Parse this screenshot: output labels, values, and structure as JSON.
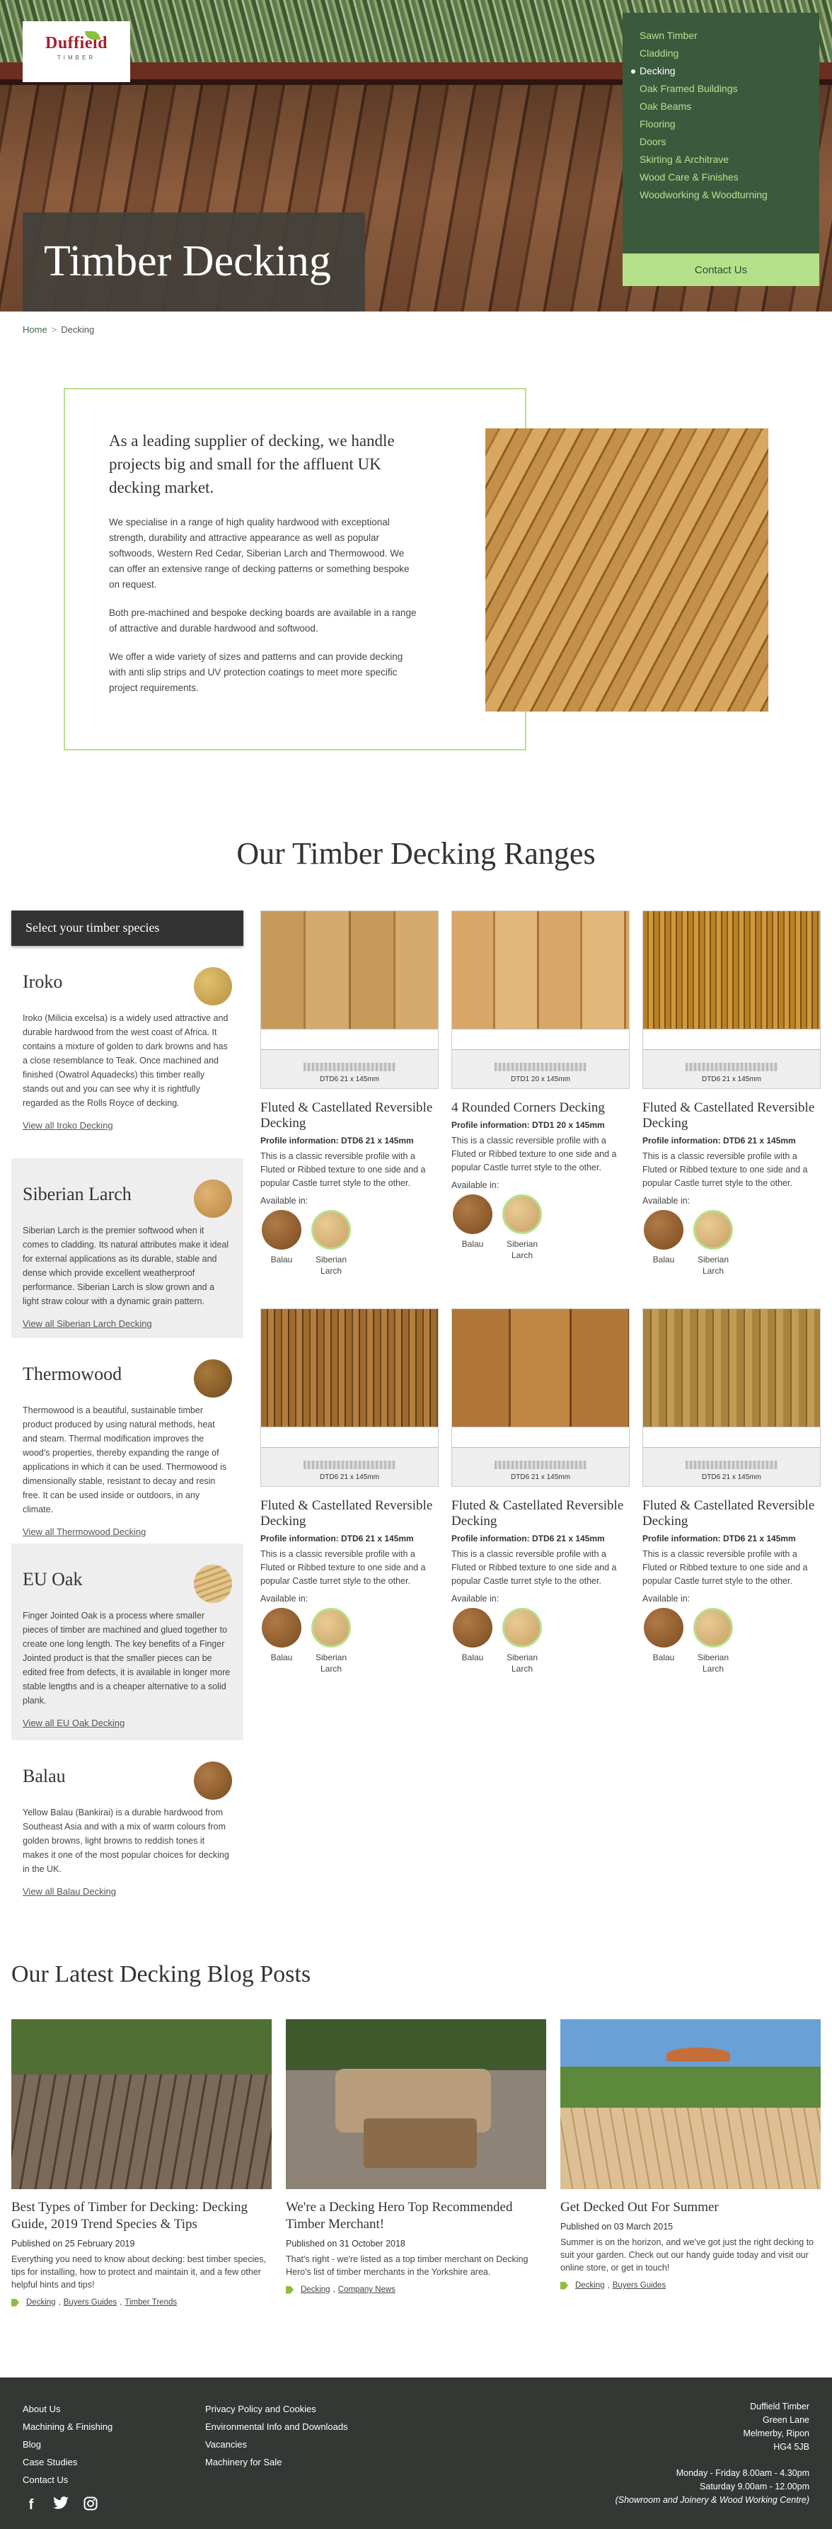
{
  "logo": {
    "name": "Duffield",
    "sub": "TIMBER"
  },
  "nav": {
    "items": [
      "Sawn Timber",
      "Cladding",
      "Decking",
      "Oak Framed Buildings",
      "Oak Beams",
      "Flooring",
      "Doors",
      "Skirting & Architrave",
      "Wood Care & Finishes",
      "Woodworking & Woodturning"
    ],
    "active": "Decking",
    "contact_label": "Contact Us"
  },
  "hero": {
    "title": "Timber Decking"
  },
  "breadcrumb": {
    "home": "Home",
    "current": "Decking"
  },
  "intro": {
    "heading": "As a leading supplier of decking, we handle projects big and small for the affluent UK decking market.",
    "p1": "We specialise in a range of high quality hardwood with exceptional strength, durability and attractive appearance as well as popular softwoods, Western Red Cedar, Siberian Larch and Thermowood. We can offer an extensive range of decking patterns or something bespoke on request.",
    "p2": "Both pre-machined and bespoke decking boards are available in a range of attractive and durable hardwood and softwood.",
    "p3": "We offer a wide variety of sizes and patterns and can provide decking with anti slip strips and UV protection coatings to meet more specific project requirements."
  },
  "ranges": {
    "title": "Our Timber Decking Ranges",
    "sidebar_title": "Select your timber species",
    "species": [
      {
        "name": "Iroko",
        "text": "Iroko (Milicia excelsa) is a widely used attractive and durable hardwood from the west coast of Africa. It contains a mixture of golden to dark browns and has a close resemblance to Teak. Once machined and finished (Owatrol Aquadecks) this timber really stands out and you can see why it is rightfully regarded as the Rolls Royce of decking.",
        "link": "View all Iroko Decking"
      },
      {
        "name": "Siberian Larch",
        "text": "Siberian Larch is the premier softwood when it comes to cladding. Its natural attributes make it ideal for external applications as its durable, stable and dense which provide excellent weatherproof performance. Siberian Larch is slow grown and a light straw colour with a dynamic grain pattern.",
        "link": "View all Siberian Larch Decking"
      },
      {
        "name": "Thermowood",
        "text": "Thermowood is a beautiful, sustainable timber product produced by using natural methods, heat and steam. Thermal modification improves the wood's properties, thereby expanding the range of applications in which it can be used. Thermowood is dimensionally stable, resistant to decay and resin free. It can be used inside or outdoors, in any climate.",
        "link": "View all Thermowood Decking"
      },
      {
        "name": "EU Oak",
        "text": "Finger Jointed Oak is a process where smaller pieces of timber are machined and glued together to create one long length. The key benefits of a Finger Jointed product is that the smaller pieces can be edited free from defects, it is available in longer more stable lengths and is a cheaper alternative to a solid plank.",
        "link": "View all EU Oak Decking"
      },
      {
        "name": "Balau",
        "text": "Yellow Balau (Bankirai) is a durable hardwood from Southeast Asia and with a mix of warm colours from golden browns, light browns to reddish tones it makes it one of the most popular choices for decking in the UK.",
        "link": "View all Balau Decking"
      }
    ],
    "products": [
      {
        "dim": "DTD6 21 x 145mm",
        "title": "Fluted & Castellated Reversible Decking",
        "info": "Profile information: DTD6 21 x 145mm",
        "desc": "This is a classic reversible profile with a Fluted or Ribbed texture to one side and a popular Castle turret style to the other.",
        "avail": "Available in:",
        "sw1": "Balau",
        "sw2": "Siberian Larch"
      },
      {
        "dim": "DTD1 20 x 145mm",
        "title": "4 Rounded Corners Decking",
        "info": "Profile information: DTD1 20 x 145mm",
        "desc": "This is a classic reversible profile with a Fluted or Ribbed texture to one side and a popular Castle turret style to the other.",
        "avail": "Available in:",
        "sw1": "Balau",
        "sw2": "Siberian Larch"
      },
      {
        "dim": "DTD6 21 x 145mm",
        "title": "Fluted & Castellated Reversible Decking",
        "info": "Profile information: DTD6 21 x 145mm",
        "desc": "This is a classic reversible profile with a Fluted or Ribbed texture to one side and a popular Castle turret style to the other.",
        "avail": "Available in:",
        "sw1": "Balau",
        "sw2": "Siberian Larch"
      },
      {
        "dim": "DTD6 21 x 145mm",
        "title": "Fluted & Castellated Reversible Decking",
        "info": "Profile information: DTD6 21 x 145mm",
        "desc": "This is a classic reversible profile with a Fluted or Ribbed texture to one side and a popular Castle turret style to the other.",
        "avail": "Available in:",
        "sw1": "Balau",
        "sw2": "Siberian Larch"
      },
      {
        "dim": "DTD6 21 x 145mm",
        "title": "Fluted & Castellated Reversible Decking",
        "info": "Profile information: DTD6 21 x 145mm",
        "desc": "This is a classic reversible profile with a Fluted or Ribbed texture to one side and a popular Castle turret style to the other.",
        "avail": "Available in:",
        "sw1": "Balau",
        "sw2": "Siberian Larch"
      },
      {
        "dim": "DTD6 21 x 145mm",
        "title": "Fluted & Castellated Reversible Decking",
        "info": "Profile information: DTD6 21 x 145mm",
        "desc": "This is a classic reversible profile with a Fluted or Ribbed texture to one side and a popular Castle turret style to the other.",
        "avail": "Available in:",
        "sw1": "Balau",
        "sw2": "Siberian Larch"
      }
    ]
  },
  "blog": {
    "title": "Our Latest Decking Blog Posts",
    "posts": [
      {
        "title": "Best Types of Timber for Decking: Decking Guide, 2019 Trend Species & Tips",
        "date": "Published on 25 February 2019",
        "excerpt": "Everything you need to know about decking: best timber species, tips for installing, how to protect and maintain it, and a few other helpful hints and tips!",
        "tags": [
          "Decking",
          "Buyers Guides",
          "Timber Trends"
        ]
      },
      {
        "title": "We're a Decking Hero Top Recommended Timber Merchant!",
        "date": "Published on 31 October 2018",
        "excerpt": "That's right - we're listed as a top timber merchant on Decking Hero's list of timber merchants in the Yorkshire area.",
        "tags": [
          "Decking",
          "Company News"
        ]
      },
      {
        "title": "Get Decked Out For Summer",
        "date": "Published on 03 March 2015",
        "excerpt": "Summer is on the horizon, and we've got just the right decking to suit your garden. Check out our handy guide today and visit our online store, or get in touch!",
        "tags": [
          "Decking",
          "Buyers Guides"
        ]
      }
    ]
  },
  "footer": {
    "col1": [
      "About Us",
      "Machining & Finishing",
      "Blog",
      "Case Studies",
      "Contact Us"
    ],
    "col2": [
      "Privacy Policy and Cookies",
      "Environmental Info and Downloads",
      "Vacancies",
      "Machinery for Sale"
    ],
    "address": [
      "Duffield Timber",
      "Green Lane",
      "Melmerby, Ripon",
      "HG4 5JB"
    ],
    "hours1": "Monday - Friday 8.00am - 4.30pm",
    "hours2": "Saturday 9.00am - 12.00pm",
    "hours_note": "(Showroom and Joinery & Wood Working Centre)"
  }
}
